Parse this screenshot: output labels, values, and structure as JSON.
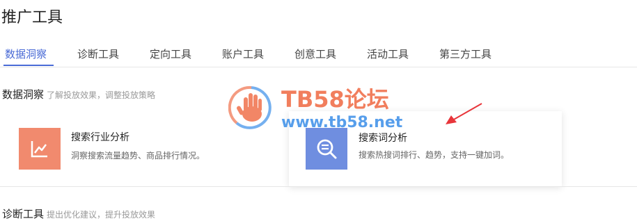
{
  "page_title": "推广工具",
  "tabs": [
    {
      "label": "数据洞察"
    },
    {
      "label": "诊断工具"
    },
    {
      "label": "定向工具"
    },
    {
      "label": "账户工具"
    },
    {
      "label": "创意工具"
    },
    {
      "label": "活动工具"
    },
    {
      "label": "第三方工具"
    }
  ],
  "section1": {
    "title": "数据洞察",
    "description": "了解投放效果，调整投放策略",
    "cards": [
      {
        "title": "搜索行业分析",
        "description": "洞察搜索流量趋势、商品排行情况。",
        "icon": "line-chart-icon",
        "color": "#f18a6e"
      },
      {
        "title": "搜索词分析",
        "description": "搜索热搜词排行、趋势，支持一键加词。",
        "icon": "search-analysis-icon",
        "color": "#6f8ee0"
      }
    ]
  },
  "section2": {
    "title": "诊断工具",
    "description": "提出优化建议，提升投放效果"
  },
  "watermark": {
    "title": "TB58论坛",
    "url": "www.tb58.net"
  },
  "colors": {
    "accent": "#4a6bd6",
    "card1_icon": "#f18a6e",
    "card2_icon": "#6f8ee0",
    "annotation_arrow": "#e8353a"
  }
}
